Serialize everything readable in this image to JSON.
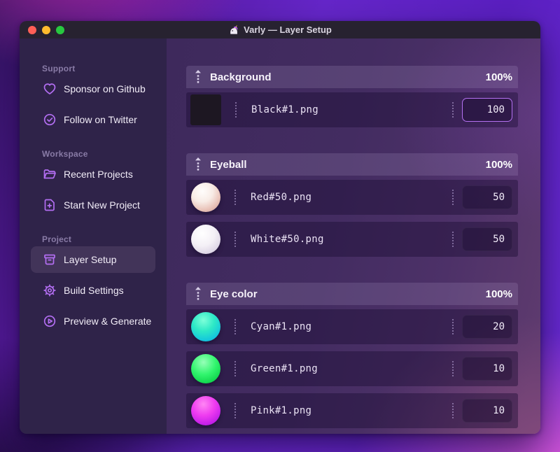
{
  "window": {
    "title": "Varly — Layer Setup"
  },
  "sidebar": {
    "sections": [
      {
        "label": "Support",
        "items": [
          {
            "label": "Sponsor on Github",
            "icon": "heart-icon"
          },
          {
            "label": "Follow on Twitter",
            "icon": "badge-check-icon"
          }
        ]
      },
      {
        "label": "Workspace",
        "items": [
          {
            "label": "Recent Projects",
            "icon": "folder-icon"
          },
          {
            "label": "Start New Project",
            "icon": "document-plus-icon"
          }
        ]
      },
      {
        "label": "Project",
        "items": [
          {
            "label": "Layer Setup",
            "icon": "archive-box-icon",
            "active": true
          },
          {
            "label": "Build Settings",
            "icon": "gear-icon"
          },
          {
            "label": "Preview & Generate",
            "icon": "play-circle-icon"
          }
        ]
      }
    ]
  },
  "layers": {
    "groups": [
      {
        "name": "Background",
        "weight": "100%",
        "items": [
          {
            "file": "Black#1.png",
            "value": "100",
            "thumb": "black-square"
          }
        ]
      },
      {
        "name": "Eyeball",
        "weight": "100%",
        "items": [
          {
            "file": "Red#50.png",
            "value": "50",
            "thumb": "red-ball"
          },
          {
            "file": "White#50.png",
            "value": "50",
            "thumb": "white-ball"
          }
        ]
      },
      {
        "name": "Eye color",
        "weight": "100%",
        "items": [
          {
            "file": "Cyan#1.png",
            "value": "20",
            "thumb": "cyan-ball"
          },
          {
            "file": "Green#1.png",
            "value": "10",
            "thumb": "green-ball"
          },
          {
            "file": "Pink#1.png",
            "value": "10",
            "thumb": "pink-ball"
          }
        ]
      }
    ]
  },
  "colors": {
    "accent": "#b36ef2",
    "focus_border": "#b571f2",
    "sidebar_bg": "#2f2349",
    "titlebar_bg": "#272230",
    "traffic_close": "#ff5f57",
    "traffic_minimize": "#febc2e",
    "traffic_zoom": "#28c840"
  }
}
